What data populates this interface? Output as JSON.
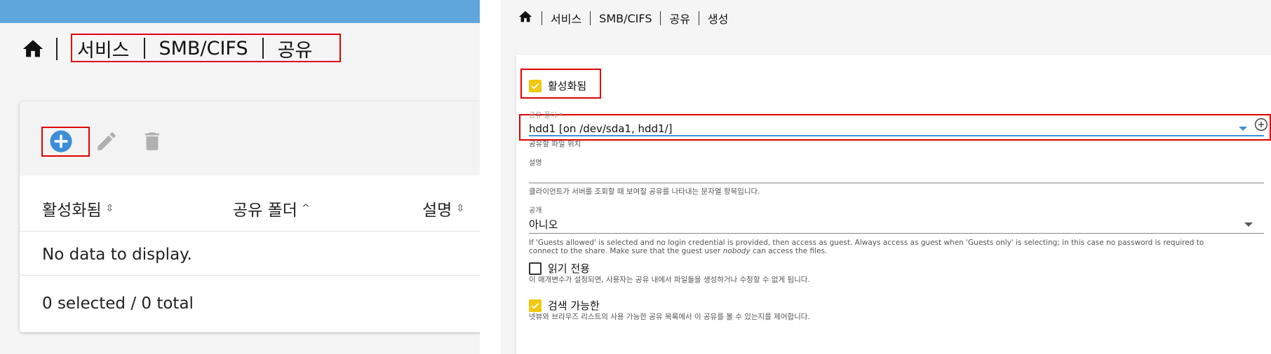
{
  "left": {
    "breadcrumb": [
      "서비스",
      "SMB/CIFS",
      "공유"
    ],
    "table": {
      "columns": [
        {
          "label": "활성화됨",
          "sort": "⇳"
        },
        {
          "label": "공유 폴더",
          "sort": "^"
        },
        {
          "label": "설명",
          "sort": "⇳"
        }
      ],
      "empty_text": "No data to display.",
      "footer": "0 selected / 0 total"
    },
    "colors": {
      "accent": "#3b8fd9",
      "topbar": "#5ea6dc",
      "highlight": "#e00000"
    }
  },
  "right": {
    "breadcrumb": [
      "서비스",
      "SMB/CIFS",
      "공유",
      "생성"
    ],
    "enabled": {
      "label": "활성화됨",
      "checked": true
    },
    "shared_folder": {
      "label": "공유 폴더 *",
      "value": "hdd1 [on /dev/sda1, hdd1/]",
      "hint": "공유할 파일 위치"
    },
    "description": {
      "label": "설명",
      "value": "",
      "hint": "클라이언트가 서버를 조회할 때 보여질 공유를 나타내는 문자열 항목입니다."
    },
    "public": {
      "label": "공개",
      "value": "아니오",
      "hint_1": "If 'Guests allowed' is selected and no login credential is provided, then access as guest. Always access as guest when 'Guests only' is selecting; in this case no password is required to",
      "hint_2a": "connect to the share. Make sure that the guest user ",
      "hint_2b": "nobody",
      "hint_2c": " can access the files."
    },
    "read_only": {
      "label": "읽기 전용",
      "checked": false,
      "hint": "이 매개변수가 설정되면, 사용자는 공유 내에서 파일들을 생성하거나 수정할 수 없게 됩니다."
    },
    "browseable": {
      "label": "검색 가능한",
      "checked": true,
      "hint": "넷뷰와 브라우즈 리스트의 사용 가능한 공유 목록에서 이 공유를 볼 수 있는지를 제어합니다."
    },
    "colors": {
      "checkbox": "#f2c811",
      "focus_underline": "#3b8fd9"
    }
  }
}
